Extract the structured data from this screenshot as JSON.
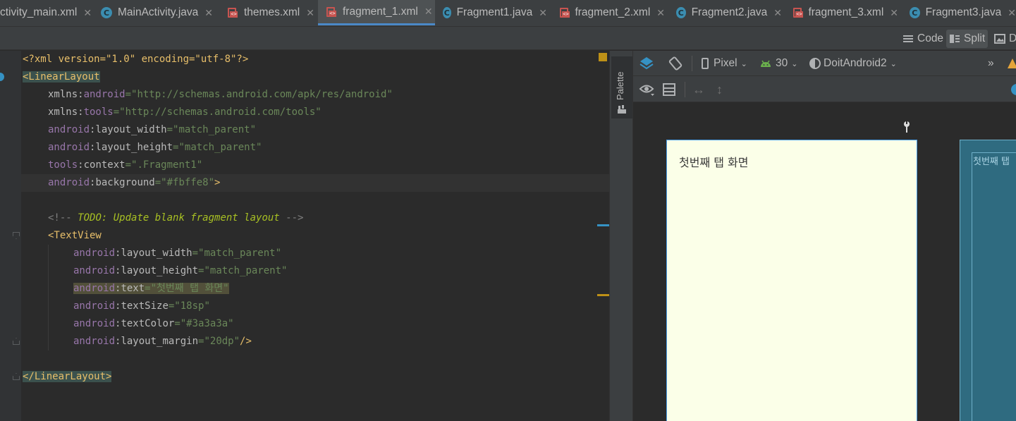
{
  "tabs": [
    {
      "label": "ctivity_main.xml",
      "kind": "xml-partial",
      "active": false
    },
    {
      "label": "MainActivity.java",
      "kind": "java",
      "active": false
    },
    {
      "label": "themes.xml",
      "kind": "xml",
      "active": false
    },
    {
      "label": "fragment_1.xml",
      "kind": "xml",
      "active": true
    },
    {
      "label": "Fragment1.java",
      "kind": "java",
      "active": false
    },
    {
      "label": "fragment_2.xml",
      "kind": "xml",
      "active": false
    },
    {
      "label": "Fragment2.java",
      "kind": "java",
      "active": false
    },
    {
      "label": "fragment_3.xml",
      "kind": "xml",
      "active": false
    },
    {
      "label": "Fragment3.java",
      "kind": "java",
      "active": false
    }
  ],
  "view_modes": {
    "code": "Code",
    "split": "Split",
    "design": "D",
    "selected": "Split"
  },
  "code": {
    "l1_pi": "<?xml version=\"1.0\" encoding=\"utf-8\"?>",
    "l2_tag": "<LinearLayout",
    "l3_prefix": "xmlns:",
    "l3_attr": "android",
    "l3_val": "=\"http://schemas.android.com/apk/res/android\"",
    "l4_prefix": "xmlns:",
    "l4_attr": "tools",
    "l4_val": "=\"http://schemas.android.com/tools\"",
    "l5_ns": "android",
    "l5_attr": ":layout_width",
    "l5_val": "=\"match_parent\"",
    "l6_ns": "android",
    "l6_attr": ":layout_height",
    "l6_val": "=\"match_parent\"",
    "l7_ns": "tools",
    "l7_attr": ":context",
    "l7_val": "=\".Fragment1\"",
    "l8_ns": "android",
    "l8_attr": ":background",
    "l8_val": "=\"#fbffe8\"",
    "l8_close": ">",
    "l10_open": "<!-- ",
    "l10_todo": "TODO: Update blank fragment layout",
    "l10_close": " -->",
    "l11_tag": "<TextView",
    "l12_ns": "android",
    "l12_attr": ":layout_width",
    "l12_val": "=\"match_parent\"",
    "l13_ns": "android",
    "l13_attr": ":layout_height",
    "l13_val": "=\"match_parent\"",
    "l14_ns": "android",
    "l14_attr": ":text",
    "l14_val": "=\"첫번째 탭 화면\"",
    "l15_ns": "android",
    "l15_attr": ":textSize",
    "l15_val": "=\"18sp\"",
    "l16_ns": "android",
    "l16_attr": ":textColor",
    "l16_val": "=\"#3a3a3a\"",
    "l17_ns": "android",
    "l17_attr": ":layout_margin",
    "l17_val": "=\"20dp\"",
    "l17_close": "/>",
    "l19_tag": "</LinearLayout>"
  },
  "palette": {
    "label": "Palette"
  },
  "design_toolbar": {
    "device": "Pixel",
    "api": "30",
    "theme": "DoitAndroid2",
    "overflow": "»"
  },
  "preview": {
    "text": "첫번째 탭 화면",
    "blueprint_text": "첫번째 탭",
    "background": "#fbffe8",
    "text_color": "#3a3a3a"
  }
}
